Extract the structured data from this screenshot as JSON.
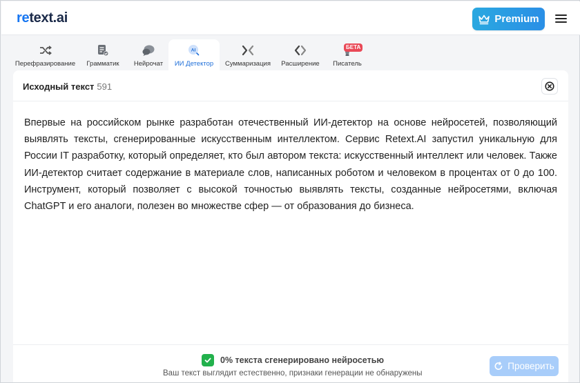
{
  "header": {
    "logo_prefix": "re",
    "logo_rest": "text.ai",
    "premium_label": "Premium"
  },
  "tabs": [
    {
      "label": "Перефразирование",
      "icon": "shuffle-icon"
    },
    {
      "label": "Грамматик",
      "icon": "document-check-icon"
    },
    {
      "label": "Нейрочат",
      "icon": "chat-bubbles-icon"
    },
    {
      "label": "ИИ Детектор",
      "icon": "ai-detector-icon",
      "active": true
    },
    {
      "label": "Суммаризация",
      "icon": "compress-arrows-icon"
    },
    {
      "label": "Расширение",
      "icon": "expand-arrows-icon"
    },
    {
      "label": "Писатель",
      "icon": "writer-icon",
      "badge": "БЕТА"
    }
  ],
  "panel": {
    "title": "Исходный текст",
    "count": "591",
    "text": "Впервые на российском рынке разработан отечественный ИИ-детектор на основе нейросетей, позволяющий выявлять тексты, сгенерированные искусственным интеллектом. Сервис Retext.AI запустил уникальную для России IT разработку, который определяет, кто был автором текста: искусственный интеллект или человек. Также ИИ-детектор считает содержание в материале слов, написанных роботом и человеком в процентах от 0 до 100. Инструмент, который позволяет с высокой точностью выявлять тексты, созданные нейросетями, включая ChatGPT и его аналоги, полезен во множестве сфер — от образования до бизнеса."
  },
  "result": {
    "headline": "0% текста сгенерировано нейросетью",
    "subtext": "Ваш текст выглядит естественно, признаки генерации не обнаружены",
    "check_label": "Проверить"
  },
  "colors": {
    "accent": "#1877f2",
    "premium": "#2a9fe3",
    "success": "#22b14c",
    "check_button": "#a8cdfa",
    "badge": "#e94957"
  }
}
